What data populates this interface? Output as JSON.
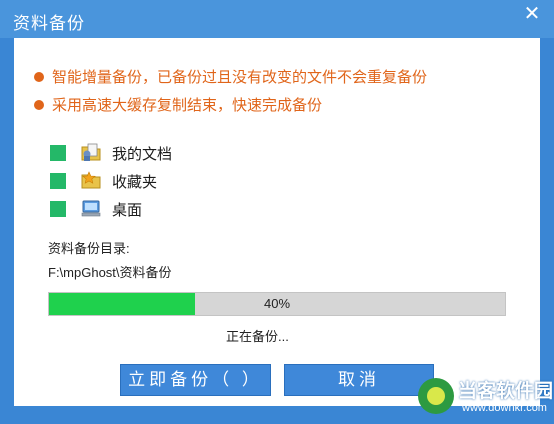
{
  "window": {
    "title": "资料备份",
    "close_glyph": "✕"
  },
  "tips": [
    {
      "icon": "bullet-dot",
      "text": "智能增量备份，已备份过且没有改变的文件不会重复备份",
      "color": "#e0651a"
    },
    {
      "icon": "bullet-dot",
      "text": "采用高速大缓存复制结束，快速完成备份",
      "color": "#e0651a"
    }
  ],
  "items": [
    {
      "label": "我的文档",
      "icon": "my-documents-icon",
      "checked": true
    },
    {
      "label": "收藏夹",
      "icon": "favorites-folder-icon",
      "checked": true
    },
    {
      "label": "桌面",
      "icon": "desktop-icon",
      "checked": true
    }
  ],
  "backup_dir": {
    "label": "资料备份目录:",
    "path": "F:\\mpGhost\\资料备份"
  },
  "progress": {
    "percent_text": "40%",
    "fraction": 0.32,
    "fill_color": "#1fd14d"
  },
  "status_text": "正在备份...",
  "buttons": {
    "backup_label": "立即备份（ ）",
    "cancel_label": "取消"
  },
  "watermark": {
    "name": "当客软件园",
    "url": "www.downkr.com"
  },
  "colors": {
    "accent": "#3a86d4",
    "check": "#24b868",
    "tip": "#e0651a"
  }
}
